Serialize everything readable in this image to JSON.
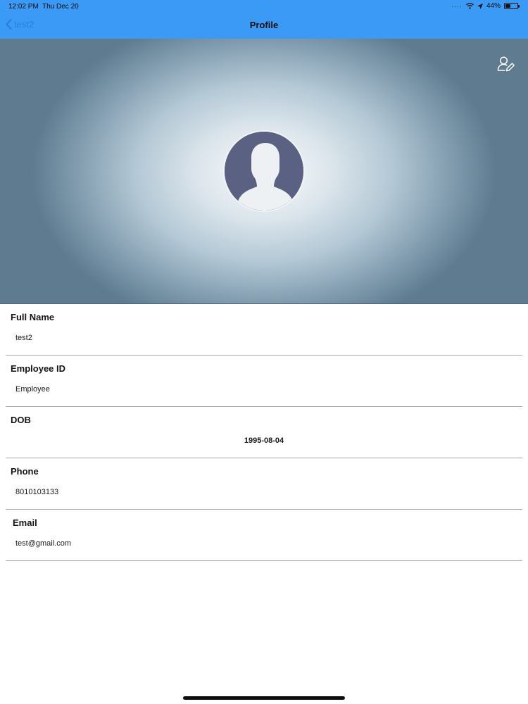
{
  "status_bar": {
    "time": "12:02 PM",
    "date": "Thu Dec 20",
    "battery": "44%",
    "battery_level": 0.44
  },
  "nav": {
    "back_label": "test2",
    "title": "Profile"
  },
  "header": {
    "edit_icon": "user-edit-icon",
    "avatar_icon": "default-user-avatar"
  },
  "fields": [
    {
      "label": "Full Name",
      "value": "test2"
    },
    {
      "label": "Employee ID",
      "value": "Employee"
    },
    {
      "label": "DOB",
      "value": "1995-08-04"
    },
    {
      "label": "Phone",
      "value": "8010103133"
    },
    {
      "label": "Email",
      "value": "test@gmail.com"
    }
  ],
  "colors": {
    "nav_bar": "#3a9af5",
    "back_link": "#2a7de1",
    "avatar_bg": "#5a6182"
  }
}
